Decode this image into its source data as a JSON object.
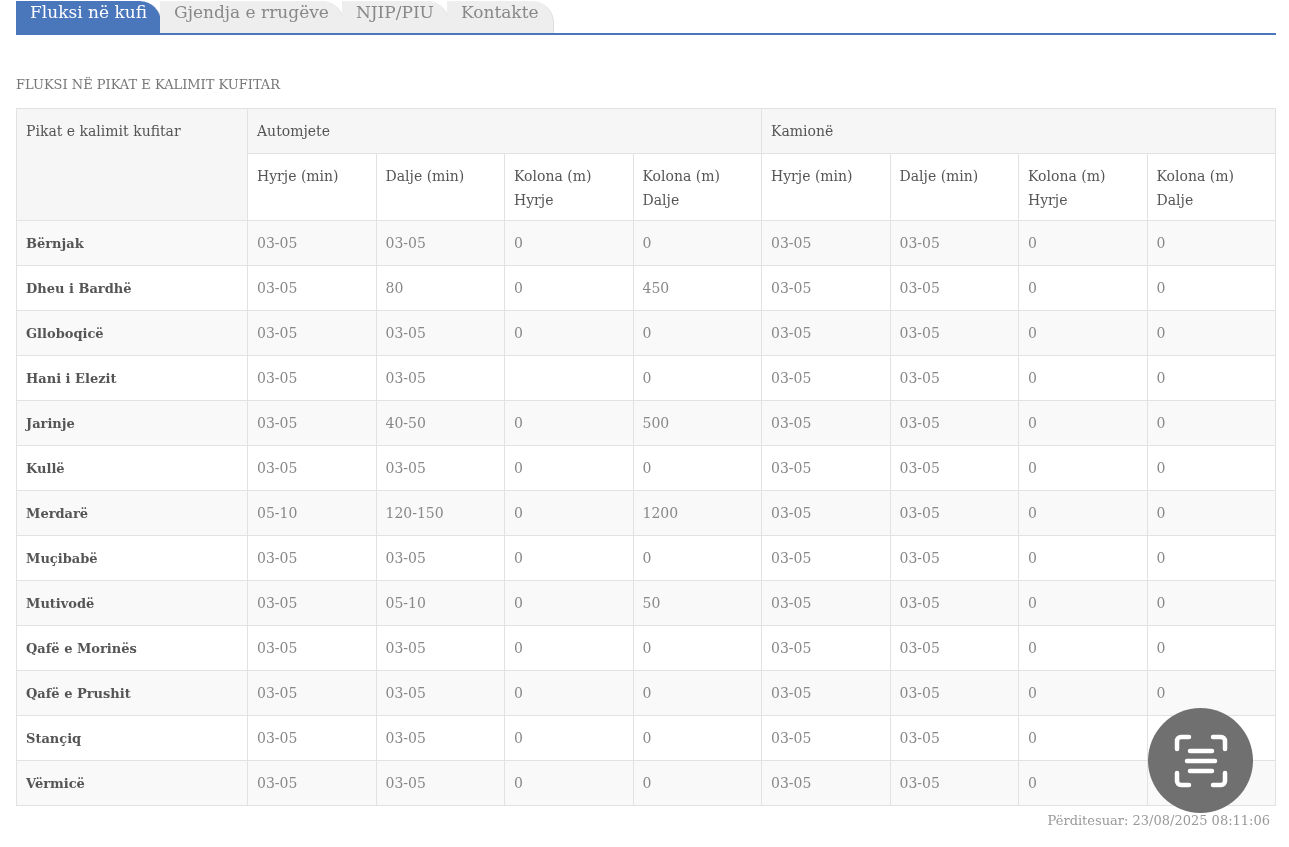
{
  "tabs": [
    {
      "label": "Fluksi në kufi",
      "selected": true
    },
    {
      "label": "Gjendja e rrugëve",
      "selected": false
    },
    {
      "label": "NJIP/PIU",
      "selected": false
    },
    {
      "label": "Kontakte",
      "selected": false
    }
  ],
  "section_title": "FLUKSI NË PIKAT E KALIMIT KUFITAR",
  "table": {
    "first_column": "Pikat e kalimit kufitar",
    "groups": [
      {
        "label": "Automjete",
        "columns": [
          "Hyrje (min)",
          "Dalje (min)",
          "Kolona (m) Hyrje",
          "Kolona (m) Dalje"
        ]
      },
      {
        "label": "Kamionë",
        "columns": [
          "Hyrje (min)",
          "Dalje (min)",
          "Kolona (m) Hyrje",
          "Kolona (m) Dalje"
        ]
      }
    ],
    "rows": [
      {
        "name": "Bërnjak",
        "cells": [
          "03-05",
          "03-05",
          "0",
          "0",
          "03-05",
          "03-05",
          "0",
          "0"
        ]
      },
      {
        "name": "Dheu i Bardhë",
        "cells": [
          "03-05",
          "80",
          "0",
          "450",
          "03-05",
          "03-05",
          "0",
          "0"
        ]
      },
      {
        "name": "Glloboqicë",
        "cells": [
          "03-05",
          "03-05",
          "0",
          "0",
          "03-05",
          "03-05",
          "0",
          "0"
        ]
      },
      {
        "name": "Hani i Elezit",
        "cells": [
          "03-05",
          "03-05",
          null,
          "0",
          "03-05",
          "03-05",
          "0",
          "0"
        ]
      },
      {
        "name": "Jarinje",
        "cells": [
          "03-05",
          "40-50",
          "0",
          "500",
          "03-05",
          "03-05",
          "0",
          "0"
        ]
      },
      {
        "name": "Kullë",
        "cells": [
          "03-05",
          "03-05",
          "0",
          "0",
          "03-05",
          "03-05",
          "0",
          "0"
        ]
      },
      {
        "name": "Merdarë",
        "cells": [
          "05-10",
          "120-150",
          "0",
          "1200",
          "03-05",
          "03-05",
          "0",
          "0"
        ]
      },
      {
        "name": "Muçibabë",
        "cells": [
          "03-05",
          "03-05",
          "0",
          "0",
          "03-05",
          "03-05",
          "0",
          "0"
        ]
      },
      {
        "name": "Mutivodë",
        "cells": [
          "03-05",
          "05-10",
          "0",
          "50",
          "03-05",
          "03-05",
          "0",
          "0"
        ]
      },
      {
        "name": "Qafë e Morinës",
        "cells": [
          "03-05",
          "03-05",
          "0",
          "0",
          "03-05",
          "03-05",
          "0",
          "0"
        ]
      },
      {
        "name": "Qafë e Prushit",
        "cells": [
          "03-05",
          "03-05",
          "0",
          "0",
          "03-05",
          "03-05",
          "0",
          "0"
        ]
      },
      {
        "name": "Stançiq",
        "cells": [
          "03-05",
          "03-05",
          "0",
          "0",
          "03-05",
          "03-05",
          "0",
          null
        ]
      },
      {
        "name": "Vërmicë",
        "cells": [
          "03-05",
          "03-05",
          "0",
          "0",
          "03-05",
          "03-05",
          "0",
          null
        ]
      }
    ]
  },
  "updated": "Përditesuar: 23/08/2025 08:11:06"
}
